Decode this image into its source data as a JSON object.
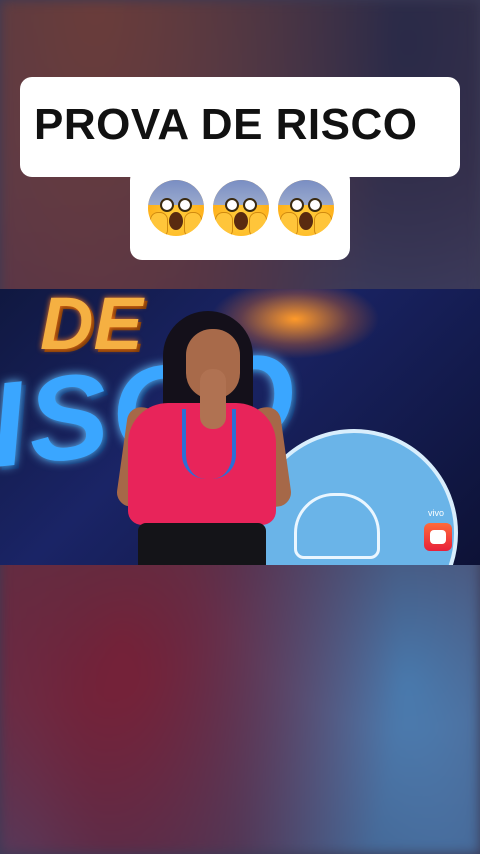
{
  "caption": {
    "title": "PROVA DE RISCO",
    "emojis": [
      "face-screaming-in-fear-emoji",
      "face-screaming-in-fear-emoji",
      "face-screaming-in-fear-emoji"
    ]
  },
  "video": {
    "live_label": "vivo",
    "channel_logo": "globo-logo-icon"
  },
  "colors": {
    "caption_bg": "#ffffff",
    "caption_text": "#111111",
    "logo_red": "#e8203a"
  }
}
